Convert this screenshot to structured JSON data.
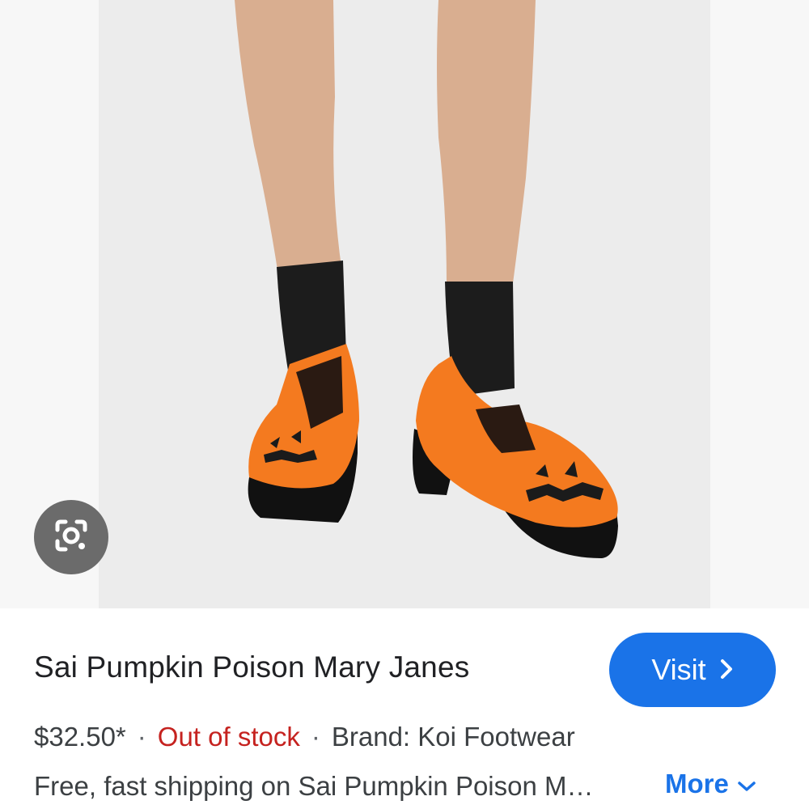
{
  "product": {
    "title": "Sai Pumpkin Poison Mary Janes",
    "price": "$32.50*",
    "separator": "·",
    "stock_status": "Out of stock",
    "brand": "Brand: Koi Footwear",
    "description": "Free, fast shipping on Sai Pumpkin Poison M…"
  },
  "actions": {
    "visit_label": "Visit",
    "more_label": "More"
  },
  "icons": {
    "lens": "camera-lens-icon",
    "visit_chevron": "chevron-right-icon",
    "more_chevron": "chevron-down-icon"
  },
  "colors": {
    "accent": "#1a73e8",
    "out_of_stock": "#c5221f",
    "shoe_orange": "#f47a1f"
  }
}
